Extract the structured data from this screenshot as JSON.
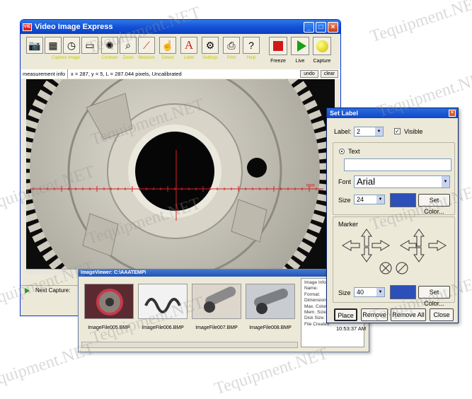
{
  "watermark": "Tequipment.NET",
  "window": {
    "title": "Video Image Express",
    "icon_text": "VIE"
  },
  "toolbar": {
    "tool_labels": [
      "Capture Image",
      "Contrast",
      "Zoom",
      "Measure",
      "Detect",
      "Label",
      "Settings",
      "Print",
      "Help"
    ],
    "freeze_label": "Freeze",
    "live_label": "Live",
    "capture_label": "Capture"
  },
  "status": {
    "info": "measurement info",
    "measurement": "x = 287, y = 5, L = 287.044 pixels, Uncalibrated",
    "undo": "undo",
    "clear": "clear"
  },
  "overlay_label": "mm",
  "next_capture": "Next Capture:",
  "image_viewer": {
    "title": "ImageViewer: C:\\AAATEMP\\",
    "files": [
      "ImageFile005.BMP",
      "ImageFile006.BMP",
      "ImageFile007.BMP",
      "ImageFile008.BMP"
    ],
    "info_title": "Image Info",
    "info_fields": [
      "Name:",
      "Format:",
      "Dimensions:",
      "Max. Colors:",
      "Mem. Size:",
      "Disk Size:",
      "File Created:"
    ]
  },
  "clock": "10:53:37 AM",
  "set_label": {
    "title": "Set Label",
    "label_caption": "Label:",
    "label_value": "2",
    "visible_label": "Visible",
    "visible_checked": true,
    "text_radio": "Text",
    "font_caption": "Font",
    "font_value": "Arial",
    "size_caption": "Size",
    "text_size": "24",
    "set_color_1": "Set Color...",
    "marker_caption": "Marker",
    "marker_size": "40",
    "set_color_2": "Set Color...",
    "place": "Place",
    "remove": "Remove",
    "remove_all": "Remove All",
    "close": "Close",
    "swatch_color": "#2c4fb8"
  }
}
